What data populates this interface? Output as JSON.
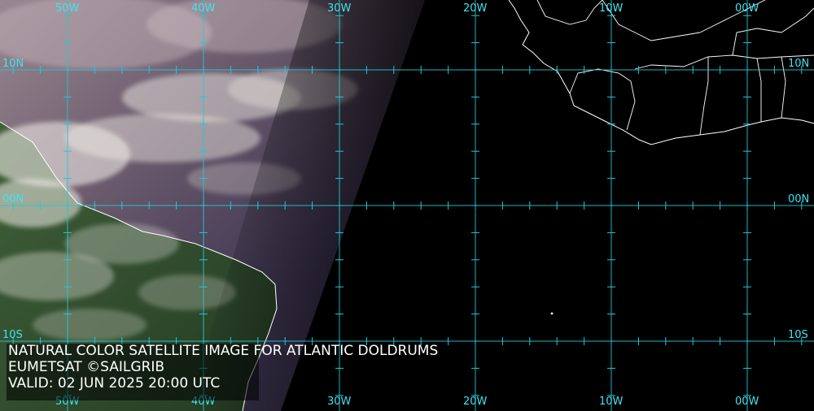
{
  "map": {
    "caption": {
      "title": "NATURAL COLOR SATELLITE IMAGE FOR ATLANTIC DOLDRUMS",
      "credit": "EUMETSAT ©SAILGRIB",
      "valid": "VALID:  02 JUN 2025 20:00 UTC"
    },
    "longitude_labels": [
      "50W",
      "40W",
      "30W",
      "20W",
      "10W",
      "00W"
    ],
    "latitude_labels": [
      "10N",
      "00N",
      "10S"
    ],
    "colors": {
      "grid": "#22c8d8",
      "label": "#3fe4f0",
      "coast_and_borders": "#ffffff",
      "night_side": "#000000",
      "cloud": "#e2dcd8",
      "ocean_day": "#3c3450",
      "land_day": "#2f4a2c"
    }
  }
}
